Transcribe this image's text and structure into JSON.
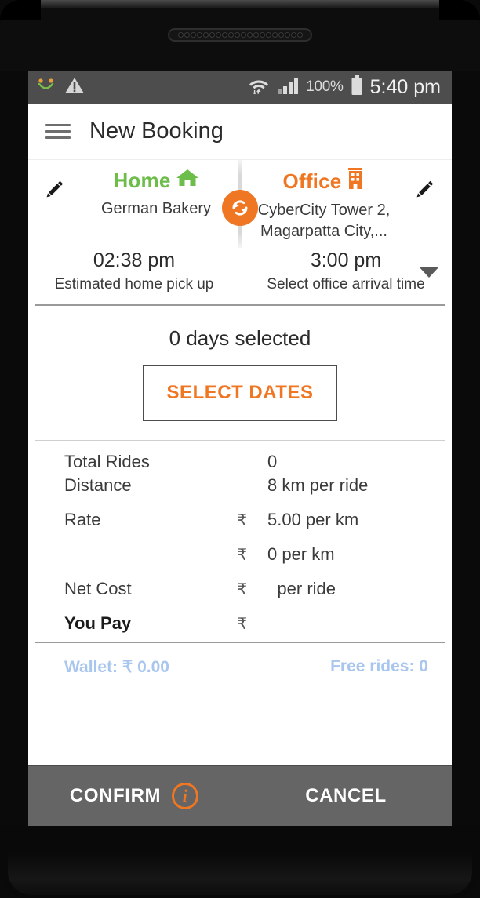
{
  "statusbar": {
    "left_icons": [
      "smiley-icon",
      "warning-triangle-icon"
    ],
    "wifi_icon": "wifi-icon",
    "signal_icon": "cellular-signal-icon",
    "battery_percent": "100%",
    "battery_icon": "battery-full-icon",
    "time": "5:40 pm"
  },
  "appbar": {
    "menu_icon": "hamburger-menu-icon",
    "title": "New Booking"
  },
  "route": {
    "swap_icon": "swap-refresh-icon",
    "origin": {
      "edit_icon": "pencil-edit-icon",
      "label": "Home",
      "icon": "home-icon",
      "color": "#6dbd4a",
      "address": "German Bakery"
    },
    "destination": {
      "edit_icon": "pencil-edit-icon",
      "label": "Office",
      "icon": "office-building-icon",
      "color": "#ef7622",
      "address": "CyberCity Tower 2, Magarpatta City,..."
    }
  },
  "times": {
    "pickup_value": "02:38 pm",
    "pickup_label": "Estimated home pick up",
    "arrival_value": "3:00 pm",
    "arrival_label": "Select office arrival time",
    "dropdown_icon": "chevron-down-icon"
  },
  "dates": {
    "count_text": "0 days selected",
    "button_label": "SELECT DATES"
  },
  "fare": {
    "currency_symbol": "₹",
    "rows": [
      {
        "label": "Total Rides",
        "currency": "",
        "value": "0"
      },
      {
        "label": "Distance",
        "currency": "",
        "value": "8 km per ride"
      },
      {
        "label": "Rate",
        "currency": "₹",
        "value": "5.00 per km"
      },
      {
        "label": "",
        "currency": "₹",
        "value": "0 per km"
      },
      {
        "label": "Net Cost",
        "currency": "₹",
        "value": "per ride"
      },
      {
        "label": "You Pay",
        "currency": "₹",
        "value": ""
      }
    ]
  },
  "wallet": {
    "balance": "Wallet: ₹ 0.00",
    "free_rides": "Free rides: 0",
    "color": "#a9c6ef"
  },
  "actions": {
    "confirm_label": "CONFIRM",
    "confirm_info_icon": "info-circle-icon",
    "cancel_label": "CANCEL"
  }
}
